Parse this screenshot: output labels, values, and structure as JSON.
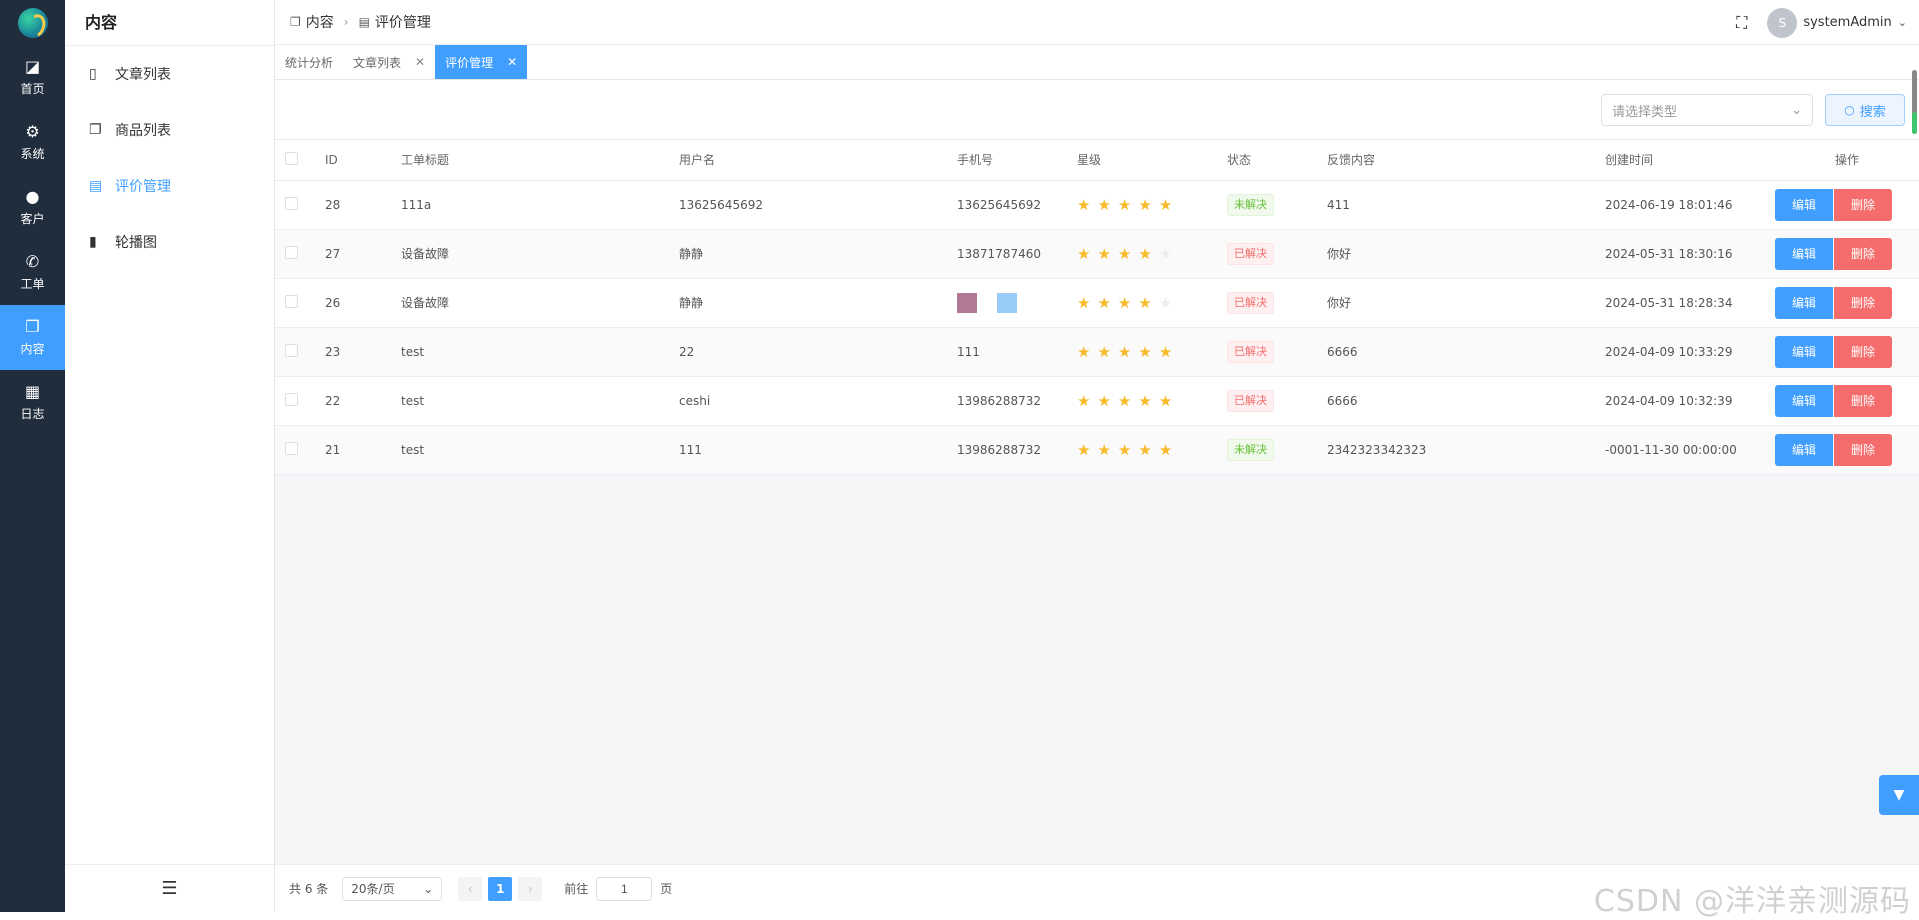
{
  "rail": {
    "items": [
      {
        "label": "首页",
        "icon": "dashboard-icon",
        "glyph": "◪",
        "active": false
      },
      {
        "label": "系统",
        "icon": "gear-icon",
        "glyph": "⚙",
        "active": false
      },
      {
        "label": "客户",
        "icon": "user-icon",
        "glyph": "●",
        "active": false
      },
      {
        "label": "工单",
        "icon": "phone-icon",
        "glyph": "✆",
        "active": false
      },
      {
        "label": "内容",
        "icon": "document-copy-icon",
        "glyph": "❐",
        "active": true
      },
      {
        "label": "日志",
        "icon": "calendar-icon",
        "glyph": "▦",
        "active": false
      }
    ]
  },
  "subnav": {
    "title": "内容",
    "items": [
      {
        "label": "文章列表",
        "icon": "document-icon",
        "glyph": "▯",
        "active": false
      },
      {
        "label": "商品列表",
        "icon": "document-copy-icon",
        "glyph": "❐",
        "active": false
      },
      {
        "label": "评价管理",
        "icon": "document-icon",
        "glyph": "▤",
        "active": true
      },
      {
        "label": "轮播图",
        "icon": "clipboard-icon",
        "glyph": "▮",
        "active": false
      }
    ]
  },
  "header": {
    "crumbs": [
      "内容",
      "评价管理"
    ],
    "username": "systemAdmin",
    "avatar_letter": "S"
  },
  "tabs": [
    {
      "label": "统计分析",
      "closable": false,
      "active": false
    },
    {
      "label": "文章列表",
      "closable": true,
      "active": false
    },
    {
      "label": "评价管理",
      "closable": true,
      "active": true
    }
  ],
  "toolbar": {
    "type_placeholder": "请选择类型",
    "search_label": "搜索"
  },
  "table": {
    "columns": [
      "ID",
      "工单标题",
      "用户名",
      "手机号",
      "星级",
      "状态",
      "反馈内容",
      "创建时间",
      "操作"
    ],
    "rows": [
      {
        "id": "28",
        "title": "111a",
        "user": "13625645692",
        "phone": "13625645692",
        "stars": 5,
        "status": "未解决",
        "resolved": false,
        "feedback": "411",
        "created": "2024-06-19 18:01:46"
      },
      {
        "id": "27",
        "title": "设备故障",
        "user": "静静",
        "phone": "13871787460",
        "stars": 4,
        "status": "已解决",
        "resolved": true,
        "feedback": "你好",
        "created": "2024-05-31 18:30:16"
      },
      {
        "id": "26",
        "title": "设备故障",
        "user": "静静",
        "phone": "",
        "stars": 4,
        "status": "已解决",
        "resolved": true,
        "feedback": "你好",
        "created": "2024-05-31 18:28:34"
      },
      {
        "id": "23",
        "title": "test",
        "user": "22",
        "phone": "111",
        "stars": 5,
        "status": "已解决",
        "resolved": true,
        "feedback": "6666",
        "created": "2024-04-09 10:33:29"
      },
      {
        "id": "22",
        "title": "test",
        "user": "ceshi",
        "phone": "13986288732",
        "stars": 5,
        "status": "已解决",
        "resolved": true,
        "feedback": "6666",
        "created": "2024-04-09 10:32:39"
      },
      {
        "id": "21",
        "title": "test",
        "user": "111",
        "phone": "13986288732",
        "stars": 5,
        "status": "未解决",
        "resolved": false,
        "feedback": "2342323342323",
        "created": "-0001-11-30 00:00:00"
      }
    ],
    "edit_label": "编辑",
    "delete_label": "删除"
  },
  "pager": {
    "total": "共 6 条",
    "page_size": "20条/页",
    "current_page": "1",
    "goto_label": "前往",
    "goto_value": "1",
    "page_suffix": "页"
  },
  "watermark": "CSDN @洋洋亲测源码",
  "colors": {
    "rail_bg": "#1f2d3d",
    "accent": "#409eff",
    "danger": "#f56c6c",
    "success": "#67c23a",
    "star": "#f7ba2a"
  }
}
